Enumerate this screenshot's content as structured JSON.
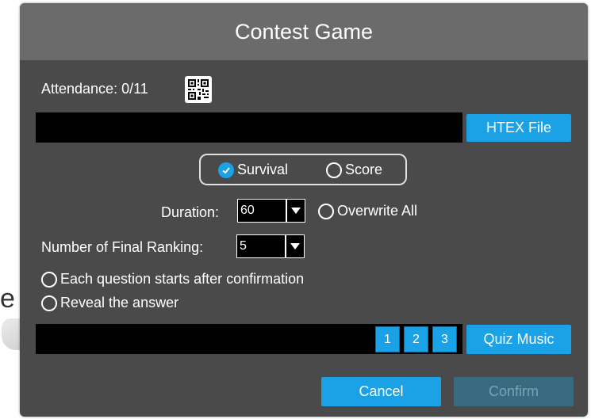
{
  "background": {
    "partial_letter": "e"
  },
  "dialog": {
    "title": "Contest Game",
    "attendance_label": "Attendance: 0/11",
    "qr_icon": "qr-code-icon",
    "file_path_value": "",
    "htex_button_label": "HTEX File",
    "mode": {
      "options": [
        "Survival",
        "Score"
      ],
      "selected": "Survival"
    },
    "duration": {
      "label": "Duration:",
      "value": "60",
      "overwrite_all_label": "Overwrite All"
    },
    "final_ranking": {
      "label": "Number of Final Ranking:",
      "value": "5"
    },
    "options": {
      "each_question_label": "Each question starts after confirmation",
      "reveal_answer_label": "Reveal the answer"
    },
    "music": {
      "path_value": "",
      "track_buttons": [
        "1",
        "2",
        "3"
      ],
      "quiz_music_label": "Quiz Music"
    },
    "footer": {
      "cancel_label": "Cancel",
      "confirm_label": "Confirm"
    },
    "colors": {
      "accent": "#1ba1e6",
      "panel": "#4a4a4a",
      "titlebar": "#6b6b6b",
      "disabled_button": "#3a6a80"
    }
  }
}
